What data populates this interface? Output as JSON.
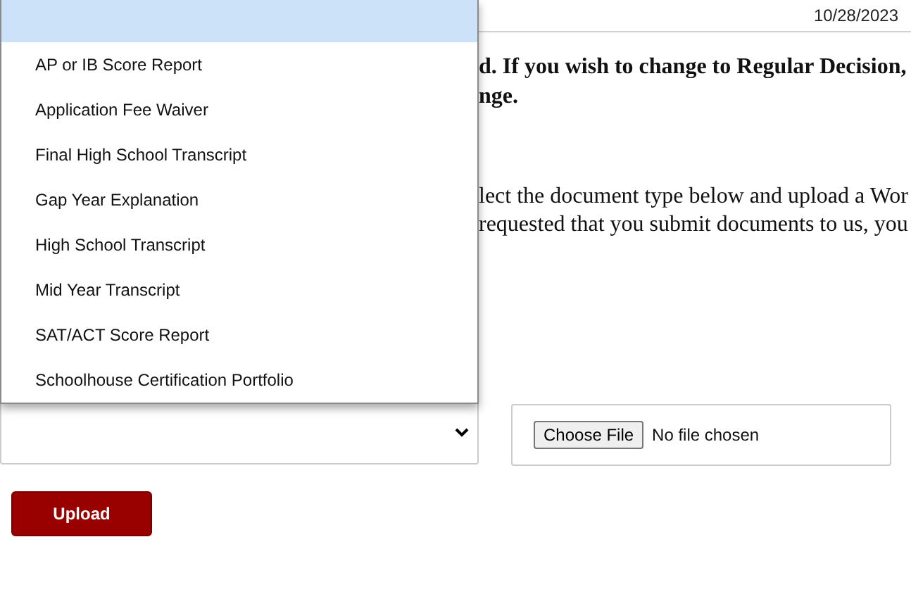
{
  "header": {
    "date": "10/28/2023"
  },
  "notice": {
    "lines": [
      "d. If you wish to change to Regular Decision,",
      "nge."
    ]
  },
  "instructions": {
    "lines": [
      "lect the document type below and upload a Wor",
      "requested that you submit documents to us, you"
    ]
  },
  "form": {
    "document_type": {
      "expanded": true
    },
    "file": {
      "button": "Choose File",
      "status": "No file chosen"
    },
    "upload_button": "Upload"
  },
  "dropdown": {
    "blank_option": {
      "selected": true
    },
    "options": [
      {
        "label": "AP or IB Score Report",
        "selected": false
      },
      {
        "label": "Application Fee Waiver",
        "selected": false
      },
      {
        "label": "Final High School Transcript",
        "selected": false
      },
      {
        "label": "Gap Year Explanation",
        "selected": false
      },
      {
        "label": "High School Transcript",
        "selected": false
      },
      {
        "label": "Mid Year Transcript",
        "selected": false
      },
      {
        "label": "SAT/ACT Score Report",
        "selected": false
      },
      {
        "label": "Schoolhouse Certification Portfolio",
        "selected": false
      }
    ]
  }
}
